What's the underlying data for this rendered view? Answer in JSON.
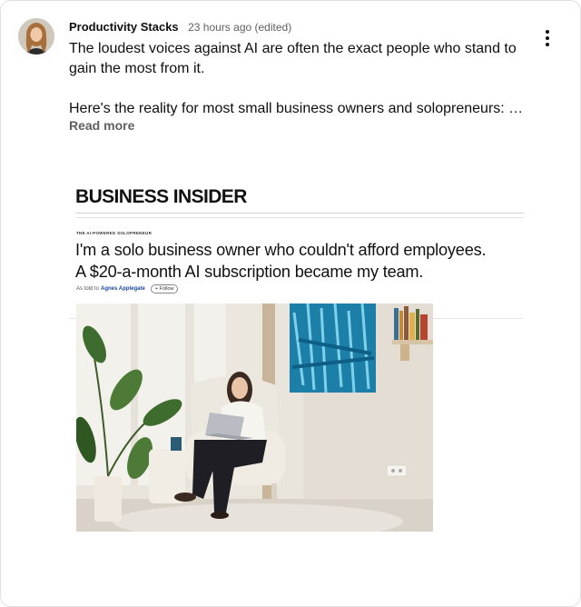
{
  "post": {
    "author": "Productivity Stacks",
    "timestamp": "23 hours ago (edited)",
    "line1": "The loudest voices against AI are often the exact people who stand to",
    "line2": "gain the most from it.",
    "line3": "Here's the reality for most small business owners and solopreneurs: …",
    "read_more": "Read more"
  },
  "article": {
    "publication": "BUSINESS INSIDER",
    "kicker": "THE AI-POWERED SOLOPRENEUR",
    "headline_line1": "I'm a solo business owner who couldn't afford employees.",
    "headline_line2": "A $20-a-month AI subscription became my team.",
    "byline_prefix": "As told to",
    "byline_author": "Agnes Applegate",
    "follow_label": "+ Follow"
  },
  "icons": {
    "menu": "more-vert-icon"
  },
  "colors": {
    "author_text": "#0f0f0f",
    "secondary_text": "#606060",
    "byline_link": "#1a4aa0"
  }
}
